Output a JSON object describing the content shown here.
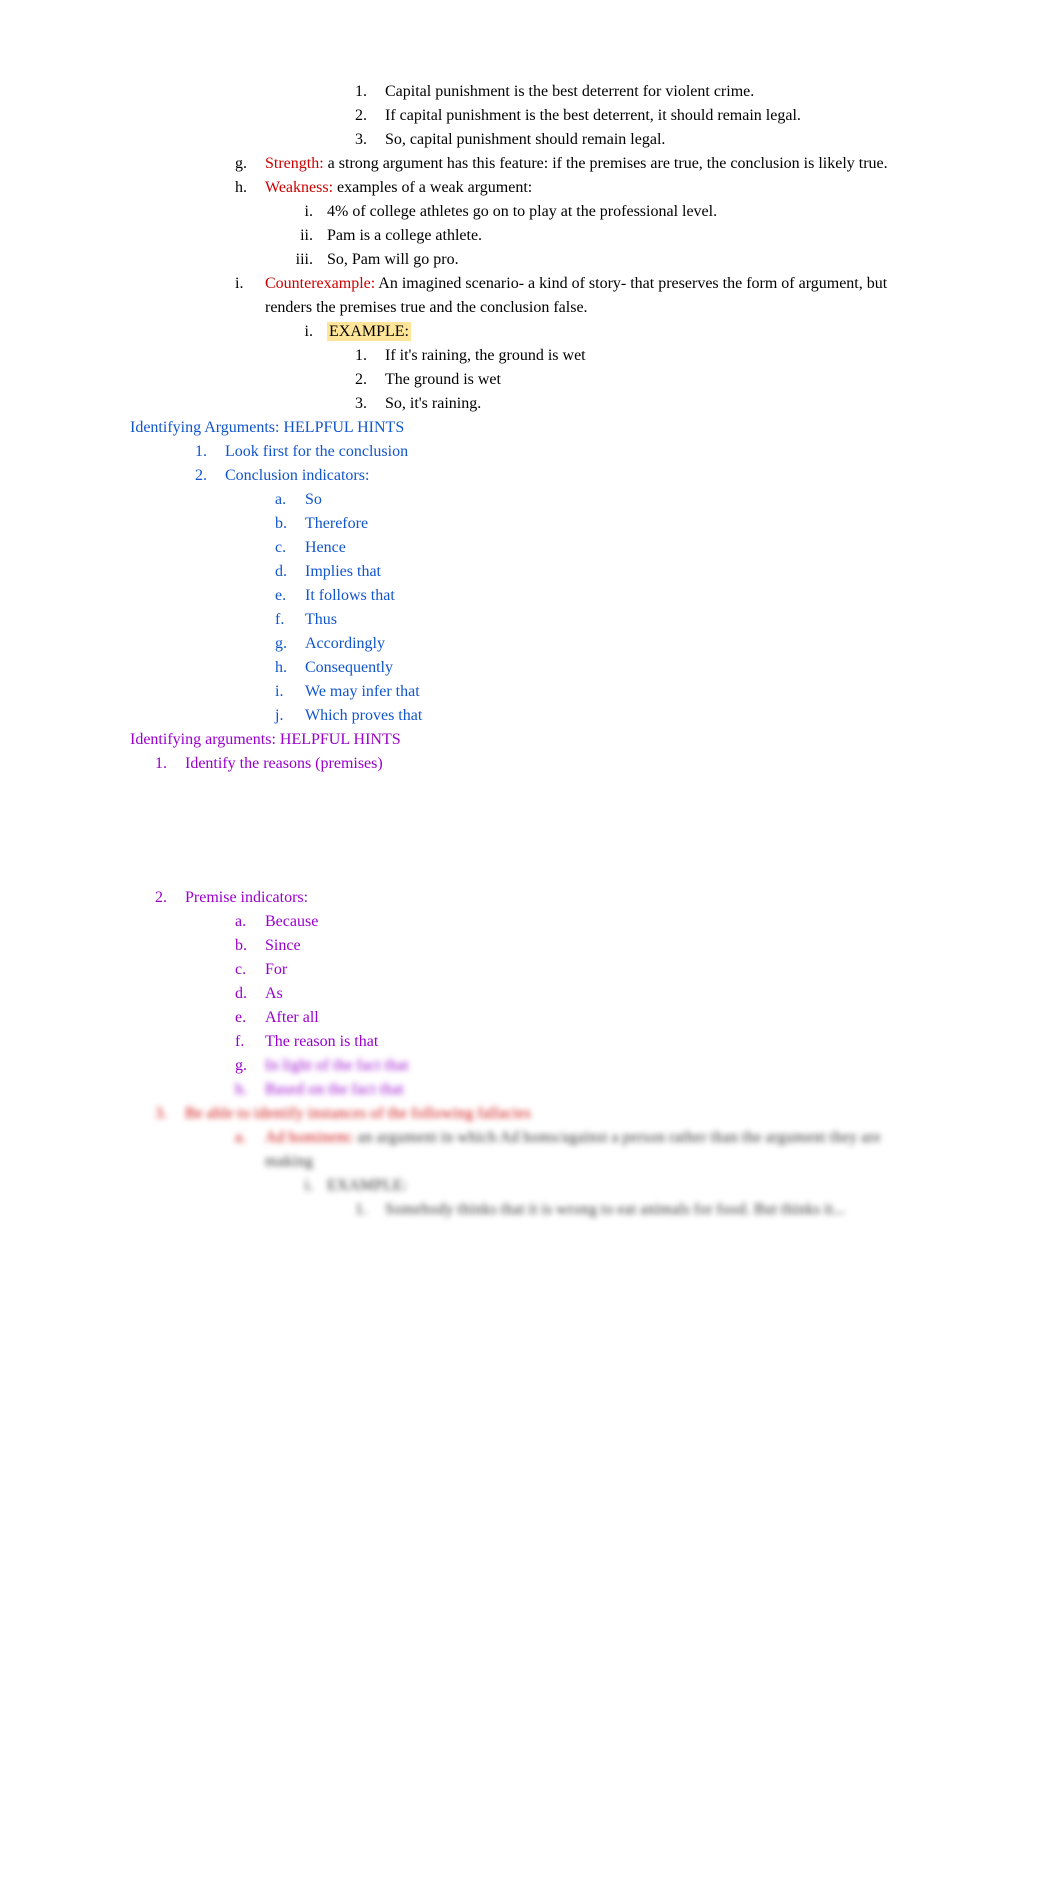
{
  "lines": {
    "l1_1": "1.",
    "l1_1t": "Capital punishment is the best deterrent for violent crime.",
    "l1_2": "2.",
    "l1_2t": "If capital punishment is the best deterrent, it should remain legal.",
    "l1_3": "3.",
    "l1_3t": "So, capital punishment should remain legal.",
    "g_m": "g.",
    "g_label": "Strength:",
    "g_text": "    a strong argument has this feature: if the premises are true, the conclusion is likely true.",
    "h_m": "h.",
    "h_label": "Weakness:",
    "h_text": "     examples of a weak argument:",
    "h_i_m": "i.",
    "h_i": "4% of college athletes go on to play at the professional level.",
    "h_ii_m": "ii.",
    "h_ii": "Pam is a college athlete.",
    "h_iii_m": "iii.",
    "h_iii": "So, Pam will go pro.",
    "i_m": "i.",
    "i_label": "Counterexample:",
    "i_text": "     An imagined scenario- a kind of story- that preserves the form of argument, but renders the premises true and the conclusion false.",
    "i_i_m": "i.",
    "i_i_label": "EXAMPLE:",
    "i_1_m": "1.",
    "i_1": "If it's raining, the ground is wet",
    "i_2_m": "2.",
    "i_2": "The ground is wet",
    "i_3_m": "3.",
    "i_3": "So, it's raining.",
    "sec1_title": "Identifying Arguments: HELPFUL HINTS",
    "s1_1_m": "1.",
    "s1_1": "Look first for the conclusion",
    "s1_2_m": "2.",
    "s1_2": "Conclusion indicators:",
    "ci_a_m": "a.",
    "ci_a": "So",
    "ci_b_m": "b.",
    "ci_b": "Therefore",
    "ci_c_m": "c.",
    "ci_c": "Hence",
    "ci_d_m": "d.",
    "ci_d": "Implies that",
    "ci_e_m": "e.",
    "ci_e": "It follows that",
    "ci_f_m": "f.",
    "ci_f": "Thus",
    "ci_g_m": "g.",
    "ci_g": "Accordingly",
    "ci_h_m": "h.",
    "ci_h": "Consequently",
    "ci_i_m": "i.",
    "ci_i": "We may infer that",
    "ci_j_m": "j.",
    "ci_j": "Which proves that",
    "sec2_title": "Identifying arguments: HELPFUL HINTS",
    "s2_1_m": "1.",
    "s2_1": "Identify the reasons (premises)",
    "s2_2_m": "2.",
    "s2_2": "Premise indicators:",
    "pi_a_m": "a.",
    "pi_a": "Because",
    "pi_b_m": "b.",
    "pi_b": "Since",
    "pi_c_m": "c.",
    "pi_c": "For",
    "pi_d_m": "d.",
    "pi_d": "As",
    "pi_e_m": "e.",
    "pi_e": "After all",
    "pi_f_m": "f.",
    "pi_f": "The reason is that",
    "pi_g_m": "g.",
    "pi_g": "In light of the fact that",
    "pi_h_m": "h.",
    "pi_h": "Based on the fact that",
    "s3_m": "3.",
    "s3": "Be able to identify instances of the following fallacies",
    "s3_a_m": "a.",
    "s3_a_label": "Ad hominem:",
    "s3_a_text": "an argument in which Ad homs/against a person rather than the argument they are making",
    "s3_a_i_m": "i.",
    "s3_a_i": "EXAMPLE:",
    "s3_a_1_m": "1.",
    "s3_a_1": "Somebody thinks that it is wrong to eat animals for food. But thinks it..."
  }
}
